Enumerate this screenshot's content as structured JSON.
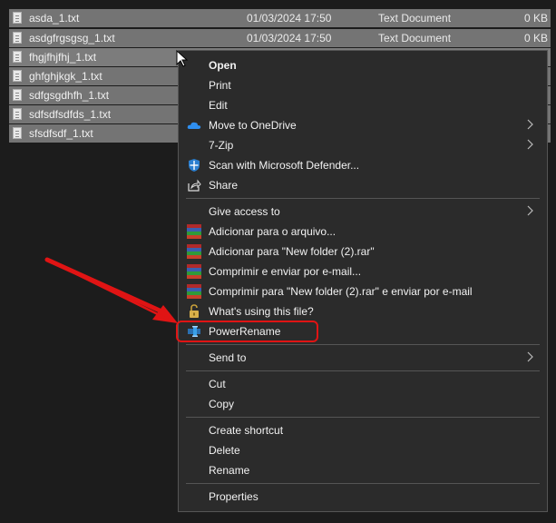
{
  "files": [
    {
      "name": "asda_1.txt",
      "date": "01/03/2024 17:50",
      "type": "Text Document",
      "size": "0 KB"
    },
    {
      "name": "asdgfrgsgsg_1.txt",
      "date": "01/03/2024 17:50",
      "type": "Text Document",
      "size": "0 KB"
    },
    {
      "name": "fhgjfhjfhj_1.txt"
    },
    {
      "name": "ghfghjkgk_1.txt"
    },
    {
      "name": "sdfgsgdhfh_1.txt"
    },
    {
      "name": "sdfsdfsdfds_1.txt"
    },
    {
      "name": "sfsdfsdf_1.txt"
    }
  ],
  "menu": {
    "open": "Open",
    "print": "Print",
    "edit": "Edit",
    "onedrive": "Move to OneDrive",
    "zip": "7-Zip",
    "defender": "Scan with Microsoft Defender...",
    "share": "Share",
    "give_access": "Give access to",
    "rar_add": "Adicionar para o arquivo...",
    "rar_add_named": "Adicionar para \"New folder (2).rar\"",
    "rar_email": "Comprimir e enviar por e-mail...",
    "rar_email_named": "Comprimir para \"New folder (2).rar\" e enviar por e-mail",
    "whats_using": "What's using this file?",
    "powerrename": "PowerRename",
    "send_to": "Send to",
    "cut": "Cut",
    "copy": "Copy",
    "create_shortcut": "Create shortcut",
    "delete": "Delete",
    "rename": "Rename",
    "properties": "Properties"
  },
  "colors": {
    "menu_bg": "#2b2b2b",
    "row_selected": "#747474",
    "highlight": "#e01414",
    "onedrive": "#2f8ff0",
    "powerrename": "#3aa0e8"
  },
  "icons": [
    "onedrive-icon",
    "defender-icon",
    "share-icon",
    "winrar-icon",
    "lock-icon",
    "powerrename-icon",
    "chevron-right-icon",
    "cursor-icon"
  ]
}
